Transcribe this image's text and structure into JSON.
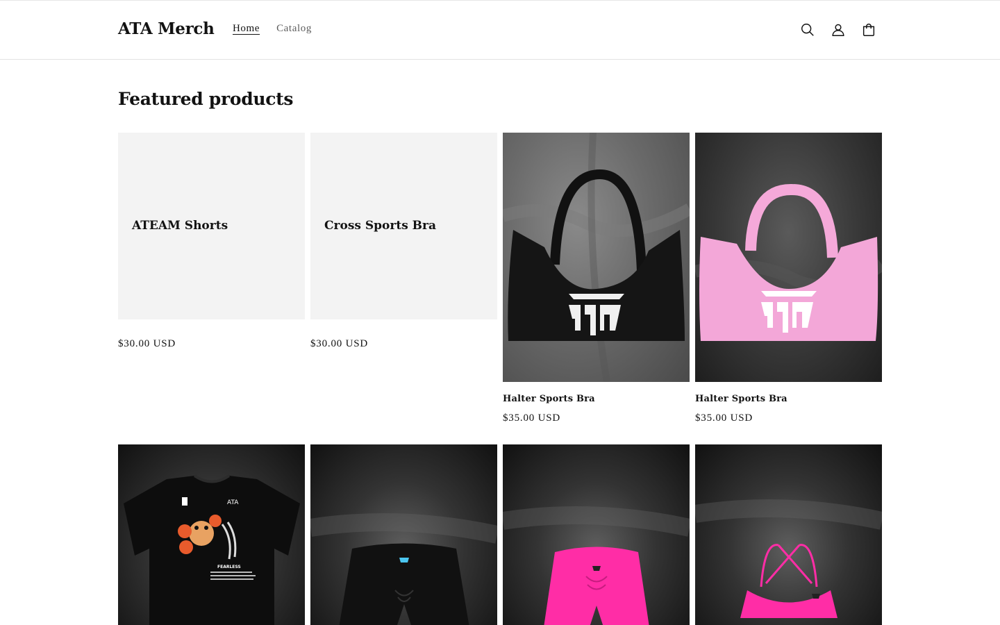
{
  "header": {
    "logo": "ATA Merch",
    "nav": [
      {
        "label": "Home",
        "active": true
      },
      {
        "label": "Catalog",
        "active": false
      }
    ],
    "icons": [
      "search-icon",
      "account-icon",
      "cart-icon"
    ]
  },
  "section": {
    "title": "Featured products"
  },
  "products": [
    {
      "title": "ATEAM Shorts",
      "price": "$30.00 USD",
      "image": "none"
    },
    {
      "title": "Cross Sports Bra",
      "price": "$30.00 USD",
      "image": "none"
    },
    {
      "title": "Halter Sports Bra",
      "price": "$35.00 USD",
      "image": "black halter bra"
    },
    {
      "title": "Halter Sports Bra",
      "price": "$35.00 USD",
      "image": "pink halter bra"
    },
    {
      "image": "black tiger t-shirt",
      "tshirt_text": [
        "ATA",
        "FEARLESS"
      ]
    },
    {
      "image": "black shorts"
    },
    {
      "image": "pink shorts"
    },
    {
      "image": "pink cross sports bra"
    }
  ],
  "colors": {
    "text": "#121212",
    "nav_inactive": "#5c5c5c",
    "placeholder_bg": "#f3f3f3",
    "pink": "#f2a6d8",
    "hot_pink": "#ff2da6",
    "border": "#e3e3e3"
  }
}
